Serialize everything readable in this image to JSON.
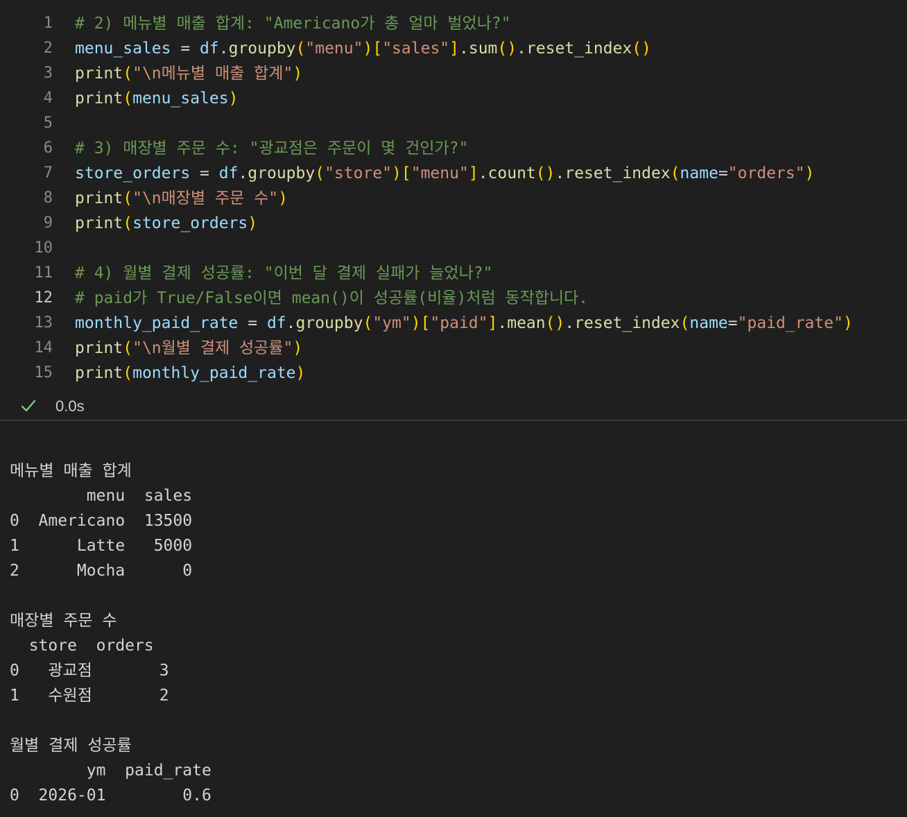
{
  "editor": {
    "lines": [
      {
        "num": "1",
        "tokens": [
          {
            "t": "# 2) 메뉴별 매출 합계: \"Americano가 총 얼마 벌었나?\"",
            "c": "comment"
          }
        ]
      },
      {
        "num": "2",
        "tokens": [
          {
            "t": "menu_sales",
            "c": "var"
          },
          {
            "t": " = ",
            "c": "op"
          },
          {
            "t": "df",
            "c": "var"
          },
          {
            "t": ".",
            "c": "op"
          },
          {
            "t": "groupby",
            "c": "func"
          },
          {
            "t": "(",
            "c": "paren"
          },
          {
            "t": "\"menu\"",
            "c": "str"
          },
          {
            "t": ")",
            "c": "paren"
          },
          {
            "t": "[",
            "c": "paren"
          },
          {
            "t": "\"sales\"",
            "c": "str"
          },
          {
            "t": "]",
            "c": "paren"
          },
          {
            "t": ".",
            "c": "op"
          },
          {
            "t": "sum",
            "c": "func"
          },
          {
            "t": "()",
            "c": "paren"
          },
          {
            "t": ".",
            "c": "op"
          },
          {
            "t": "reset_index",
            "c": "func"
          },
          {
            "t": "()",
            "c": "paren"
          }
        ]
      },
      {
        "num": "3",
        "tokens": [
          {
            "t": "print",
            "c": "func"
          },
          {
            "t": "(",
            "c": "paren"
          },
          {
            "t": "\"\\n메뉴별 매출 합계\"",
            "c": "str"
          },
          {
            "t": ")",
            "c": "paren"
          }
        ]
      },
      {
        "num": "4",
        "tokens": [
          {
            "t": "print",
            "c": "func"
          },
          {
            "t": "(",
            "c": "paren"
          },
          {
            "t": "menu_sales",
            "c": "var"
          },
          {
            "t": ")",
            "c": "paren"
          }
        ]
      },
      {
        "num": "5",
        "tokens": []
      },
      {
        "num": "6",
        "tokens": [
          {
            "t": "# 3) 매장별 주문 수: \"광교점은 주문이 몇 건인가?\"",
            "c": "comment"
          }
        ]
      },
      {
        "num": "7",
        "tokens": [
          {
            "t": "store_orders",
            "c": "var"
          },
          {
            "t": " = ",
            "c": "op"
          },
          {
            "t": "df",
            "c": "var"
          },
          {
            "t": ".",
            "c": "op"
          },
          {
            "t": "groupby",
            "c": "func"
          },
          {
            "t": "(",
            "c": "paren"
          },
          {
            "t": "\"store\"",
            "c": "str"
          },
          {
            "t": ")",
            "c": "paren"
          },
          {
            "t": "[",
            "c": "paren"
          },
          {
            "t": "\"menu\"",
            "c": "str"
          },
          {
            "t": "]",
            "c": "paren"
          },
          {
            "t": ".",
            "c": "op"
          },
          {
            "t": "count",
            "c": "func"
          },
          {
            "t": "()",
            "c": "paren"
          },
          {
            "t": ".",
            "c": "op"
          },
          {
            "t": "reset_index",
            "c": "func"
          },
          {
            "t": "(",
            "c": "paren"
          },
          {
            "t": "name",
            "c": "param"
          },
          {
            "t": "=",
            "c": "op"
          },
          {
            "t": "\"orders\"",
            "c": "str"
          },
          {
            "t": ")",
            "c": "paren"
          }
        ]
      },
      {
        "num": "8",
        "tokens": [
          {
            "t": "print",
            "c": "func"
          },
          {
            "t": "(",
            "c": "paren"
          },
          {
            "t": "\"\\n매장별 주문 수\"",
            "c": "str"
          },
          {
            "t": ")",
            "c": "paren"
          }
        ]
      },
      {
        "num": "9",
        "tokens": [
          {
            "t": "print",
            "c": "func"
          },
          {
            "t": "(",
            "c": "paren"
          },
          {
            "t": "store_orders",
            "c": "var"
          },
          {
            "t": ")",
            "c": "paren"
          }
        ]
      },
      {
        "num": "10",
        "tokens": []
      },
      {
        "num": "11",
        "tokens": [
          {
            "t": "# 4) 월별 결제 성공률: \"이번 달 결제 실패가 늘었나?\"",
            "c": "comment"
          }
        ]
      },
      {
        "num": "12",
        "active": true,
        "tokens": [
          {
            "t": "# paid가 True/False이면 mean()이 성공률(비율)처럼 동작합니다.",
            "c": "comment"
          }
        ]
      },
      {
        "num": "13",
        "tokens": [
          {
            "t": "monthly_paid_rate",
            "c": "var"
          },
          {
            "t": " = ",
            "c": "op"
          },
          {
            "t": "df",
            "c": "var"
          },
          {
            "t": ".",
            "c": "op"
          },
          {
            "t": "groupby",
            "c": "func"
          },
          {
            "t": "(",
            "c": "paren"
          },
          {
            "t": "\"ym\"",
            "c": "str"
          },
          {
            "t": ")",
            "c": "paren"
          },
          {
            "t": "[",
            "c": "paren"
          },
          {
            "t": "\"paid\"",
            "c": "str"
          },
          {
            "t": "]",
            "c": "paren"
          },
          {
            "t": ".",
            "c": "op"
          },
          {
            "t": "mean",
            "c": "func"
          },
          {
            "t": "()",
            "c": "paren"
          },
          {
            "t": ".",
            "c": "op"
          },
          {
            "t": "reset_index",
            "c": "func"
          },
          {
            "t": "(",
            "c": "paren"
          },
          {
            "t": "name",
            "c": "param"
          },
          {
            "t": "=",
            "c": "op"
          },
          {
            "t": "\"paid_rate\"",
            "c": "str"
          },
          {
            "t": ")",
            "c": "paren"
          }
        ]
      },
      {
        "num": "14",
        "tokens": [
          {
            "t": "print",
            "c": "func"
          },
          {
            "t": "(",
            "c": "paren"
          },
          {
            "t": "\"\\n월별 결제 성공률\"",
            "c": "str"
          },
          {
            "t": ")",
            "c": "paren"
          }
        ]
      },
      {
        "num": "15",
        "tokens": [
          {
            "t": "print",
            "c": "func"
          },
          {
            "t": "(",
            "c": "paren"
          },
          {
            "t": "monthly_paid_rate",
            "c": "var"
          },
          {
            "t": ")",
            "c": "paren"
          }
        ]
      }
    ]
  },
  "status": {
    "icon": "check-icon",
    "duration": "0.0s",
    "check_color": "#89d185"
  },
  "output": {
    "lines": [
      "",
      "메뉴별 매출 합계",
      "        menu  sales",
      "0  Americano  13500",
      "1      Latte   5000",
      "2      Mocha      0",
      "",
      "매장별 주문 수",
      "  store  orders",
      "0   광교점       3",
      "1   수원점       2",
      "",
      "월별 결제 성공률",
      "        ym  paid_rate",
      "0  2026-01        0.6"
    ]
  }
}
